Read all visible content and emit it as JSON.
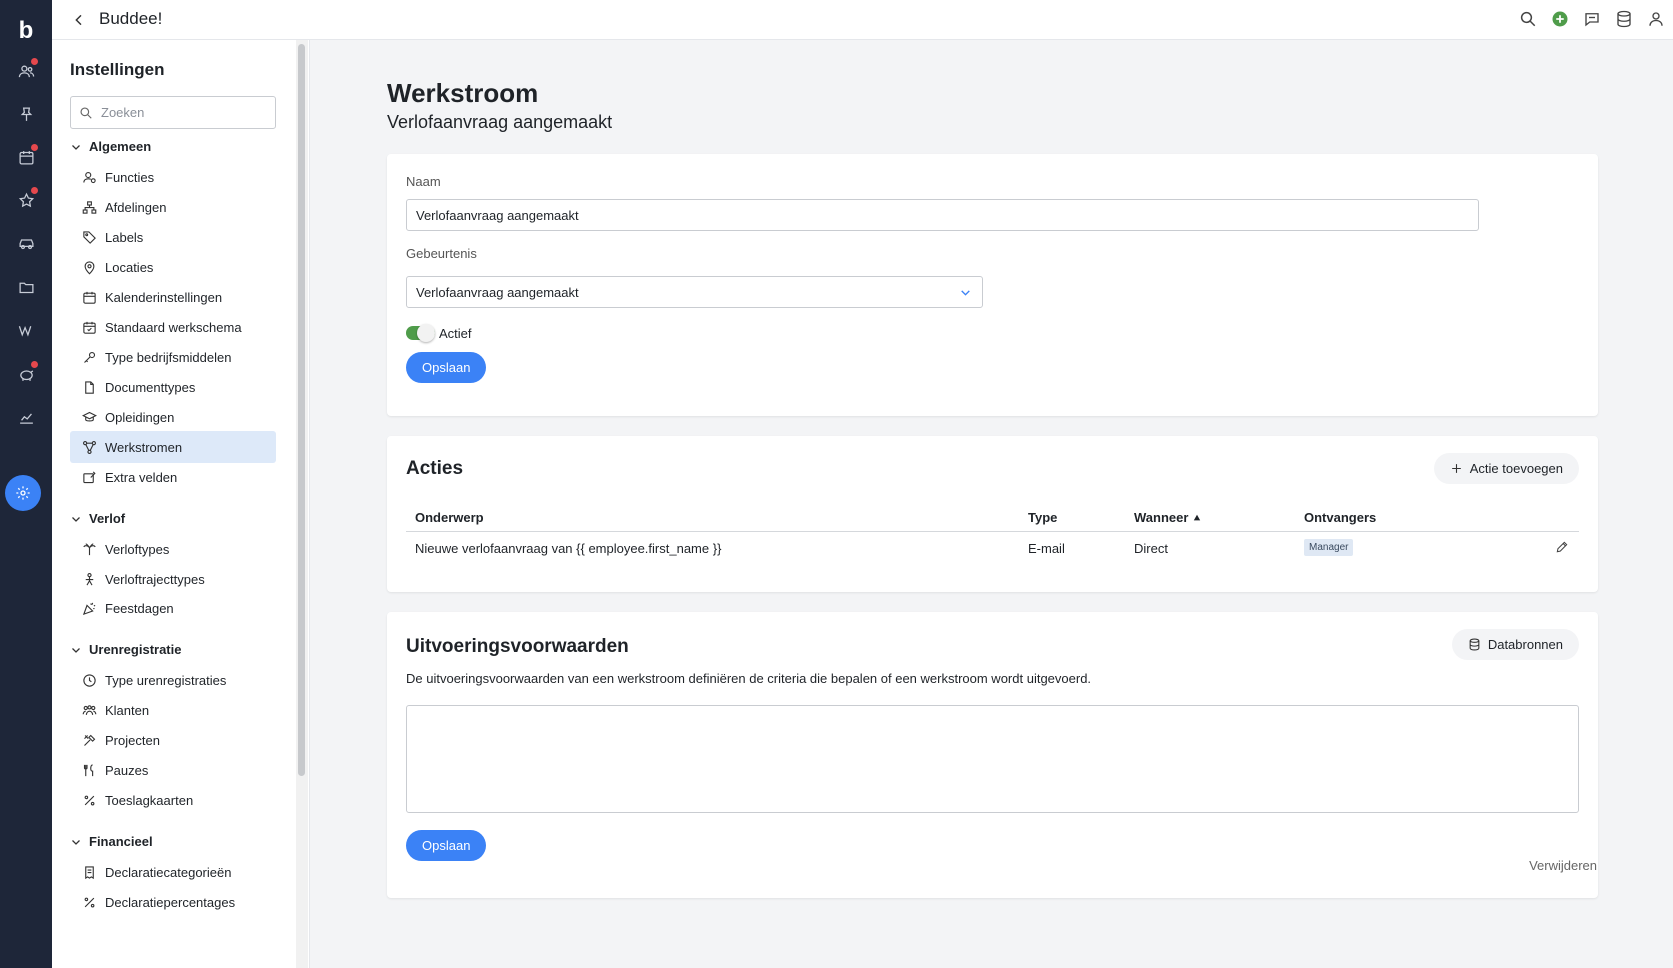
{
  "app": {
    "title": "Buddee!",
    "logo": "b"
  },
  "rail": {
    "icons": [
      {
        "name": "people-icon",
        "badge": true
      },
      {
        "name": "pin-icon",
        "badge": false
      },
      {
        "name": "calendar-icon",
        "badge": true
      },
      {
        "name": "star-icon",
        "badge": true
      },
      {
        "name": "car-icon",
        "badge": false
      },
      {
        "name": "folder-icon",
        "badge": false
      },
      {
        "name": "wiki-icon",
        "badge": false
      },
      {
        "name": "piggy-bank-icon",
        "badge": true
      },
      {
        "name": "chart-icon",
        "badge": false
      },
      {
        "name": "gear-icon",
        "active": true
      }
    ],
    "badge_color": "#e5484d",
    "active_color": "#3b82f6"
  },
  "topbar": {
    "icons": [
      "search-icon",
      "add-circle-icon",
      "chat-icon",
      "database-icon",
      "user-icon"
    ],
    "add_color": "#4f9c4a"
  },
  "settings": {
    "title": "Instellingen",
    "search_placeholder": "Zoeken",
    "sections": [
      {
        "label": "Algemeen",
        "items": [
          "Functies",
          "Afdelingen",
          "Labels",
          "Locaties",
          "Kalenderinstellingen",
          "Standaard werkschema",
          "Type bedrijfsmiddelen",
          "Documenttypes",
          "Opleidingen",
          "Werkstromen",
          "Extra velden"
        ]
      },
      {
        "label": "Verlof",
        "items": [
          "Verloftypes",
          "Verloftrajecttypes",
          "Feestdagen"
        ]
      },
      {
        "label": "Urenregistratie",
        "items": [
          "Type urenregistraties",
          "Klanten",
          "Projecten",
          "Pauzes",
          "Toeslagkaarten"
        ]
      },
      {
        "label": "Financieel",
        "items": [
          "Declaratiecategorieën",
          "Declaratiepercentages"
        ]
      }
    ],
    "active_item": "Werkstromen"
  },
  "page": {
    "title": "Werkstroom",
    "subtitle": "Verlofaanvraag aangemaakt"
  },
  "form": {
    "name_label": "Naam",
    "name_value": "Verlofaanvraag aangemaakt",
    "event_label": "Gebeurtenis",
    "event_value": "Verlofaanvraag aangemaakt",
    "active_label": "Actief",
    "active": true,
    "save_label": "Opslaan"
  },
  "actions": {
    "title": "Acties",
    "add_label": "Actie toevoegen",
    "columns": [
      "Onderwerp",
      "Type",
      "Wanneer",
      "Ontvangers"
    ],
    "sorted_column": "Wanneer",
    "rows": [
      {
        "subject": "Nieuwe verlofaanvraag van {{ employee.first_name }}",
        "type": "E-mail",
        "when": "Direct",
        "recipients": "Manager"
      }
    ]
  },
  "conditions": {
    "title": "Uitvoeringsvoorwaarden",
    "datasources_label": "Databronnen",
    "description": "De uitvoeringsvoorwaarden van een werkstroom definiëren de criteria die bepalen of een werkstroom wordt uitgevoerd.",
    "value": "",
    "save_label": "Opslaan"
  },
  "delete_label": "Verwijderen"
}
